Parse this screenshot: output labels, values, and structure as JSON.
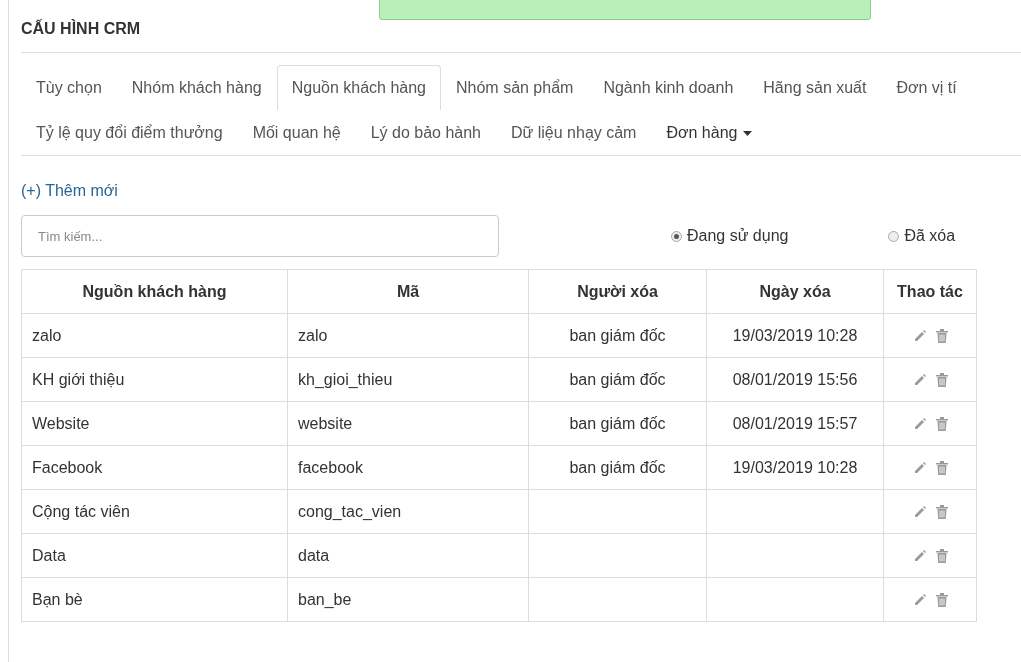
{
  "notification": {
    "kind": "success"
  },
  "title": "CẤU HÌNH CRM",
  "tabs": [
    [
      {
        "label": "Tùy chọn",
        "selected": false
      },
      {
        "label": "Nhóm khách hàng",
        "selected": false
      },
      {
        "label": "Nguồn khách hàng",
        "selected": true
      },
      {
        "label": "Nhóm sản phẩm",
        "selected": false
      },
      {
        "label": "Ngành kinh doanh",
        "selected": false
      },
      {
        "label": "Hãng sản xuất",
        "selected": false
      },
      {
        "label": "Đơn vị tí",
        "selected": false
      }
    ],
    [
      {
        "label": "Tỷ lệ quy đổi điểm thưởng",
        "selected": false
      },
      {
        "label": "Mối quan hệ",
        "selected": false
      },
      {
        "label": "Lý do bảo hành",
        "selected": false
      },
      {
        "label": "Dữ liệu nhạy cảm",
        "selected": false
      },
      {
        "label": "Đơn hàng",
        "selected": false,
        "dropdown": true
      }
    ]
  ],
  "add_link": "(+) Thêm mới",
  "search": {
    "placeholder": "Tìm kiếm..."
  },
  "filters": [
    {
      "label": "Đang sử dụng",
      "selected": true
    },
    {
      "label": "Đã xóa",
      "selected": false
    }
  ],
  "table": {
    "columns": [
      "Nguồn khách hàng",
      "Mã",
      "Người xóa",
      "Ngày xóa",
      "Thao tác"
    ],
    "rows": [
      [
        "zalo",
        "zalo",
        "ban giám đốc",
        "19/03/2019 10:28"
      ],
      [
        "KH giới thiệu",
        "kh_gioi_thieu",
        "ban giám đốc",
        "08/01/2019 15:56"
      ],
      [
        "Website",
        "website",
        "ban giám đốc",
        "08/01/2019 15:57"
      ],
      [
        "Facebook",
        "facebook",
        "ban giám đốc",
        "19/03/2019 10:28"
      ],
      [
        "Cộng tác viên",
        "cong_tac_vien",
        "",
        ""
      ],
      [
        "Data",
        "data",
        "",
        ""
      ],
      [
        "Bạn bè",
        "ban_be",
        "",
        ""
      ]
    ]
  }
}
